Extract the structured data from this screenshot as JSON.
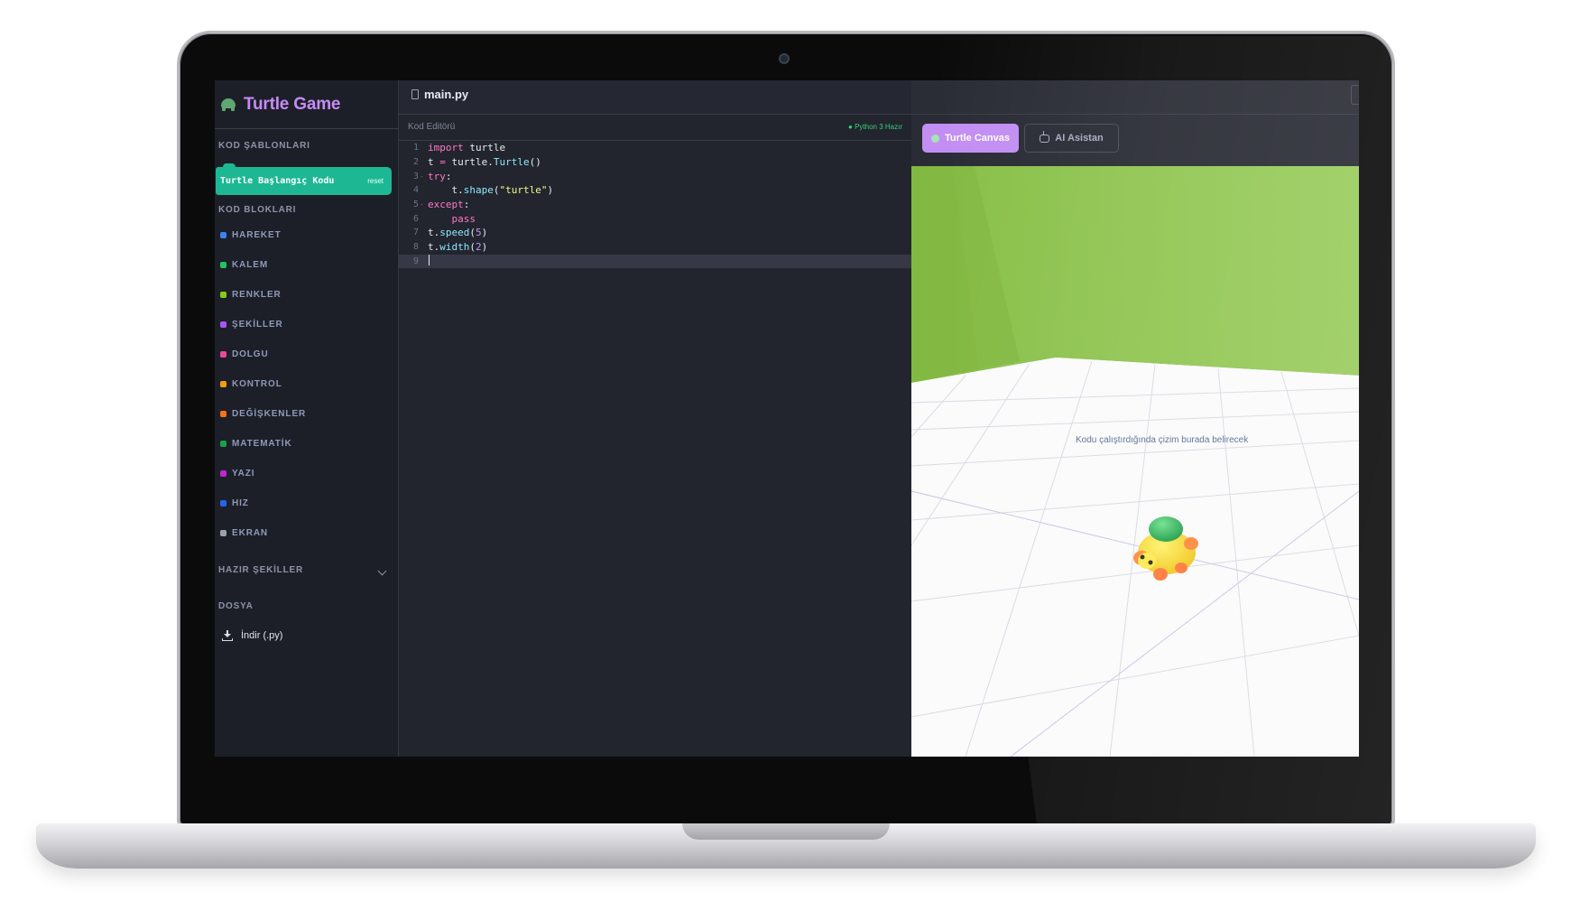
{
  "app": {
    "title": "Turtle Game"
  },
  "sidebar": {
    "templates_heading": "KOD ŞABLONLARI",
    "template_item": {
      "label": "Turtle Başlangıç Kodu",
      "reset": "reset"
    },
    "blocks_heading": "KOD BLOKLARI",
    "blocks": [
      {
        "label": "HAREKET",
        "color": "#3b82f6"
      },
      {
        "label": "KALEM",
        "color": "#22c55e"
      },
      {
        "label": "RENKLER",
        "color": "#84cc16"
      },
      {
        "label": "ŞEKİLLER",
        "color": "#a855f7"
      },
      {
        "label": "DOLGU",
        "color": "#ec4899"
      },
      {
        "label": "KONTROL",
        "color": "#f59e0b"
      },
      {
        "label": "DEĞİŞKENLER",
        "color": "#f97316"
      },
      {
        "label": "MATEMATİK",
        "color": "#16a34a"
      },
      {
        "label": "YAZI",
        "color": "#c026d3"
      },
      {
        "label": "HIZ",
        "color": "#2563eb"
      },
      {
        "label": "EKRAN",
        "color": "#9ca3af"
      }
    ],
    "ready_shapes_heading": "HAZIR ŞEKİLLER",
    "file_heading": "DOSYA",
    "download_label": "İndir (.py)"
  },
  "editor": {
    "file_name": "main.py",
    "label": "Kod Editörü",
    "status": "● Python 3 Hazır",
    "active_line": 9,
    "lines": [
      "import turtle",
      "t = turtle.Turtle()",
      "try:",
      "    t.shape(\"turtle\")",
      "except:",
      "    pass",
      "t.speed(5)",
      "t.width(2)",
      ""
    ]
  },
  "right_panel": {
    "tabs": [
      {
        "label": "Turtle Canvas",
        "active": true
      },
      {
        "label": "AI Asistan",
        "active": false
      }
    ],
    "canvas_hint": "Kodu çalıştırdığında çizim burada belirecek"
  },
  "colors": {
    "accent_purple": "#c28ef3",
    "template_green": "#1db893",
    "canvas_wall": "#8bc34a",
    "sidebar_bg": "#1d1f28",
    "editor_bg": "#22242e"
  }
}
